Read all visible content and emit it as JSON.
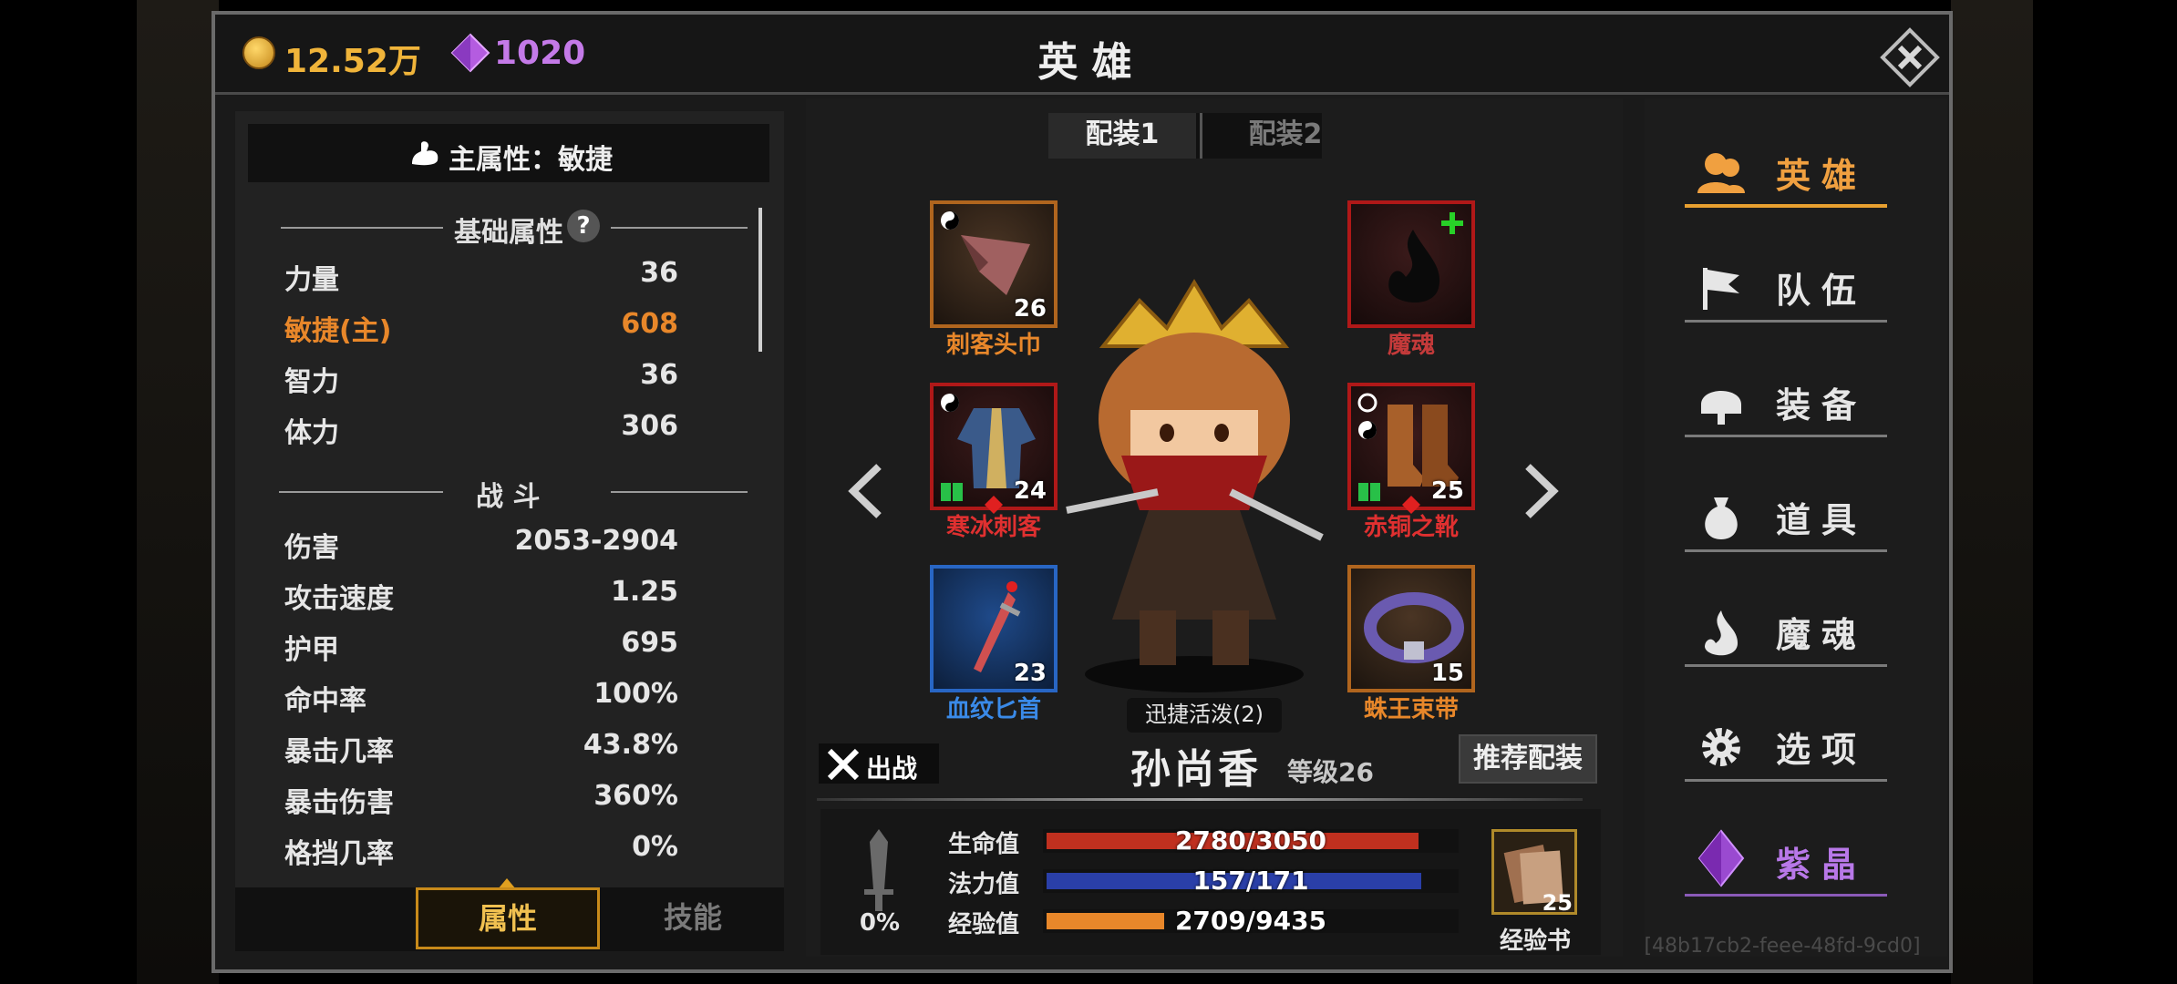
{
  "currency": {
    "gold": "12.52万",
    "gems": "1020"
  },
  "window": {
    "title": "英 雄"
  },
  "left_panel": {
    "main_attr": "主属性：敏捷",
    "basic_header": "基础属性",
    "help": "?",
    "basic": [
      {
        "k": "力量",
        "v": "36"
      },
      {
        "k": "敏捷(主)",
        "v": "608",
        "main": true
      },
      {
        "k": "智力",
        "v": "36"
      },
      {
        "k": "体力",
        "v": "306"
      }
    ],
    "combat_header": "战 斗",
    "combat": [
      {
        "k": "伤害",
        "v": "2053-2904"
      },
      {
        "k": "攻击速度",
        "v": "1.25"
      },
      {
        "k": "护甲",
        "v": "695"
      },
      {
        "k": "命中率",
        "v": "100%"
      },
      {
        "k": "暴击几率",
        "v": "43.8%"
      },
      {
        "k": "暴击伤害",
        "v": "360%"
      },
      {
        "k": "格挡几率",
        "v": "0%"
      }
    ],
    "tabs": {
      "attr": "属性",
      "skill": "技能"
    }
  },
  "loadout_tabs": [
    "配装1",
    "配装2"
  ],
  "slots": [
    {
      "name": "刺客头巾",
      "level": "26",
      "color": "#e8872a"
    },
    {
      "name": "魔魂",
      "level": "",
      "color": "#c43a3a"
    },
    {
      "name": "寒冰刺客",
      "level": "24",
      "color": "#e03030"
    },
    {
      "name": "赤铜之靴",
      "level": "25",
      "color": "#e03030"
    },
    {
      "name": "血纹匕首",
      "level": "23",
      "color": "#3a8ae8"
    },
    {
      "name": "蛛王束带",
      "level": "15",
      "color": "#e8872a"
    }
  ],
  "set_bonus": "迅捷活泼(2)",
  "hero": {
    "name": "孙尚香",
    "level": "等级26",
    "deploy": "出战",
    "recommend": "推荐配装"
  },
  "bars": {
    "hp": {
      "label": "生命值",
      "text": "2780/3050",
      "fraction": 0.911,
      "color": "#c0301f"
    },
    "mp": {
      "label": "法力值",
      "text": "157/171",
      "fraction": 0.918,
      "color": "#2a3fa8"
    },
    "xp": {
      "label": "经验值",
      "text": "2709/9435",
      "fraction": 0.287,
      "color": "#e8872a"
    }
  },
  "sword_pct": "0%",
  "exp_book": {
    "label": "经验书",
    "count": "25"
  },
  "nav": [
    "英雄",
    "队伍",
    "装备",
    "道具",
    "魔魂",
    "选项",
    "紫晶"
  ],
  "footer_id": "[48b17cb2-feee-48fd-9cd0]"
}
